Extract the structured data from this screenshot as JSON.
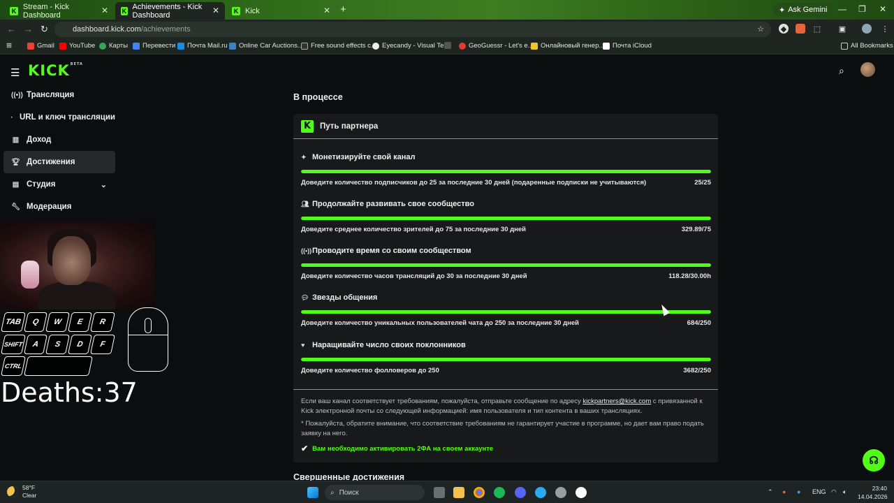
{
  "browser": {
    "tabs": [
      {
        "label": "Stream - Kick Dashboard",
        "active": false
      },
      {
        "label": "Achievements - Kick Dashboard",
        "active": true
      },
      {
        "label": "Kick",
        "active": false
      }
    ],
    "ask_gemini": "Ask Gemini",
    "url_host": "dashboard.kick.com",
    "url_path": "/achievements",
    "bookmarks": [
      "Gmail",
      "YouTube",
      "Карты",
      "Перевести",
      "Почта Mail.ru",
      "Online Car Auctions...",
      "Free sound effects c...",
      "Eyecandy - Visual Te...",
      "GeoGuessr - Let's e...",
      "Онлайновый генер...",
      "Почта iCloud"
    ],
    "all_bookmarks": "All Bookmarks"
  },
  "header": {
    "logo": "KICK",
    "logo_badge": "BETA"
  },
  "sidebar": {
    "items": [
      {
        "label": "Трансляция",
        "icon": "broadcast-icon"
      },
      {
        "label": "URL и ключ трансляции",
        "icon": "dot-icon"
      },
      {
        "label": "Доход",
        "icon": "chart-icon"
      },
      {
        "label": "Достижения",
        "icon": "trophy-icon"
      },
      {
        "label": "Студия",
        "icon": "studio-icon"
      },
      {
        "label": "Модерация",
        "icon": "wrench-icon"
      }
    ]
  },
  "overlay": {
    "keys": [
      "TAB",
      "Q",
      "W",
      "E",
      "R",
      "SHIFT",
      "A",
      "S",
      "D",
      "F",
      "CTRL"
    ],
    "deaths": "Deaths:37"
  },
  "main": {
    "in_progress_heading": "В процессе",
    "card_title": "Путь партнера",
    "requirements": [
      {
        "title": "Монетизируйте свой канал",
        "icon": "sparkle-icon",
        "desc": "Доведите количество подписчиков до 25 за последние 30 дней (подаренные подписки не учитываются)",
        "value": "25/25",
        "progress": 1.0
      },
      {
        "title": "Продолжайте развивать свое сообщество",
        "icon": "users-icon",
        "desc": "Доведите среднее количество зрителей до 75 за последние 30 дней",
        "value": "329.89/75",
        "progress": 1.0
      },
      {
        "title": "Проводите время со своим сообществом",
        "icon": "broadcast-icon",
        "desc": "Доведите количество часов трансляций до 30 за последние 30 дней",
        "value": "118.28/30.00h",
        "progress": 1.0
      },
      {
        "title": "Звезды общения",
        "icon": "chat-icon",
        "desc": "Доведите количество уникальных пользователей чата до 250 за последние 30 дней",
        "value": "684/250",
        "progress": 1.0
      },
      {
        "title": "Наращивайте число своих поклонников",
        "icon": "heart-icon",
        "desc": "Доведите количество фолловеров до 250",
        "value": "3682/250",
        "progress": 1.0
      }
    ],
    "footer_text_1": "Если ваш канал соответствует требованиям, пожалуйста, отправьте сообщение по адресу",
    "footer_email": "kickpartners@kick.com",
    "footer_text_2": "с привязанной к Kick электронной почты со следующей информацией: имя пользователя и тип контента в ваших трансляциях.",
    "footer_note": "* Пожалуйста, обратите внимание, что соответствие требованиям не гарантирует участие в программе, но дает вам право подать заявку на него.",
    "twofa_note": "Вам необходимо активировать 2ФА на своем аккаунте",
    "completed_heading": "Свершенные достижения"
  },
  "taskbar": {
    "temp": "58°F",
    "weather": "Clear",
    "search_placeholder": "Поиск",
    "lang": "ENG",
    "time": "23:40",
    "date": "14.04.2026"
  },
  "colors": {
    "accent": "#53fc18",
    "bg": "#0b0e0f",
    "card": "#17191a"
  }
}
